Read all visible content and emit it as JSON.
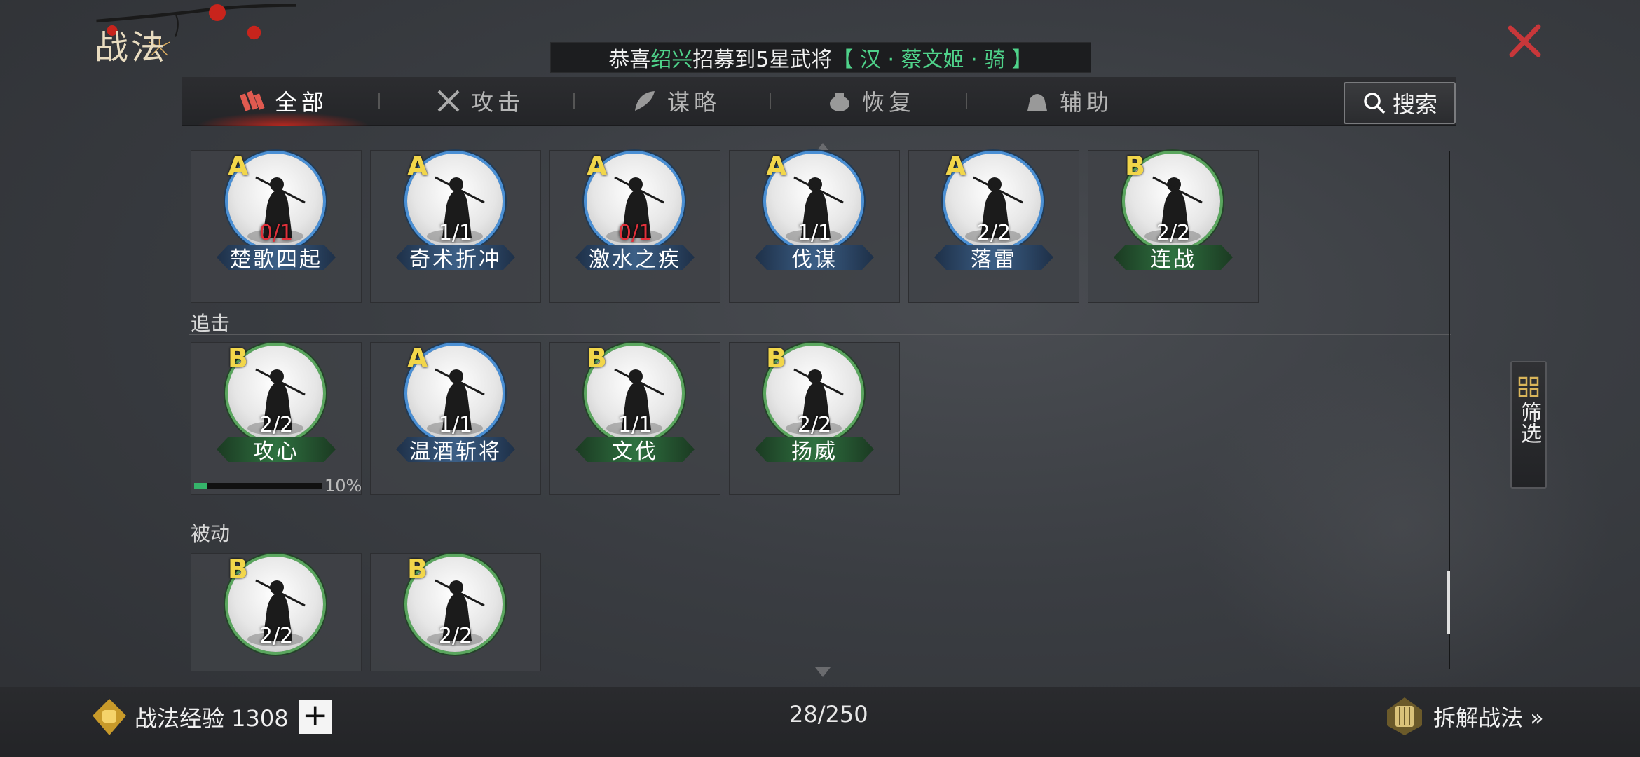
{
  "page": {
    "title": "战法"
  },
  "notice": {
    "prefix": "恭喜",
    "name": "绍兴",
    "middle": "招募到5星武将",
    "hero": "【 汉 · 蔡文姬 · 骑 】"
  },
  "tabs": [
    {
      "label": "全部",
      "icon": "scroll-bundle-icon",
      "active": true
    },
    {
      "label": "攻击",
      "icon": "crossed-swords-icon",
      "active": false
    },
    {
      "label": "谋略",
      "icon": "feather-fan-icon",
      "active": false
    },
    {
      "label": "恢复",
      "icon": "medicine-pot-icon",
      "active": false
    },
    {
      "label": "辅助",
      "icon": "pouch-icon",
      "active": false
    }
  ],
  "search": {
    "label": "搜索"
  },
  "sections": [
    {
      "label": "",
      "cards": [
        {
          "grade": "A",
          "count": "0/1",
          "name": "楚歌四起",
          "rarity": "blue",
          "count_red": true
        },
        {
          "grade": "A",
          "count": "1/1",
          "name": "奇术折冲",
          "rarity": "blue",
          "count_red": false
        },
        {
          "grade": "A",
          "count": "0/1",
          "name": "激水之疾",
          "rarity": "blue",
          "count_red": true
        },
        {
          "grade": "A",
          "count": "1/1",
          "name": "伐谋",
          "rarity": "blue",
          "count_red": false
        },
        {
          "grade": "A",
          "count": "2/2",
          "name": "落雷",
          "rarity": "blue",
          "count_red": false
        },
        {
          "grade": "B",
          "count": "2/2",
          "name": "连战",
          "rarity": "green",
          "count_red": false
        }
      ]
    },
    {
      "label": "追击",
      "cards": [
        {
          "grade": "B",
          "count": "2/2",
          "name": "攻心",
          "rarity": "green",
          "count_red": false,
          "progress": 0.1,
          "progress_label": "10%"
        },
        {
          "grade": "A",
          "count": "1/1",
          "name": "温酒斩将",
          "rarity": "blue",
          "count_red": false
        },
        {
          "grade": "B",
          "count": "1/1",
          "name": "文伐",
          "rarity": "green",
          "count_red": false
        },
        {
          "grade": "B",
          "count": "2/2",
          "name": "扬威",
          "rarity": "green",
          "count_red": false
        }
      ]
    },
    {
      "label": "被动",
      "cards": [
        {
          "grade": "B",
          "count": "2/2",
          "name": "",
          "rarity": "green",
          "count_red": false
        },
        {
          "grade": "B",
          "count": "2/2",
          "name": "",
          "rarity": "green",
          "count_red": false
        }
      ]
    }
  ],
  "filter": {
    "label": "筛选"
  },
  "bottom": {
    "exp_label": "战法经验 1308",
    "plus": "+",
    "total": "28/250",
    "dismantle": "拆解战法 »"
  },
  "colors": {
    "accent_red": "#d2281e",
    "green_text": "#4fd28a",
    "grade_gold": "#f2d64a",
    "blue_ring": "#4a8fd4",
    "green_ring": "#5aa65e"
  }
}
